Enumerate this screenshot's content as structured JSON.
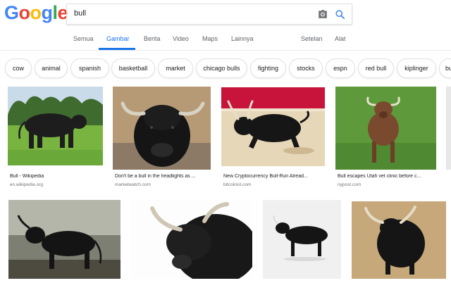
{
  "search": {
    "query": "bull"
  },
  "tabs": [
    {
      "label": "Semua"
    },
    {
      "label": "Gambar"
    },
    {
      "label": "Berita"
    },
    {
      "label": "Video"
    },
    {
      "label": "Maps"
    },
    {
      "label": "Lainnya"
    },
    {
      "label": "Setelan"
    },
    {
      "label": "Alat"
    }
  ],
  "chips": [
    "cow",
    "animal",
    "spanish",
    "basketball",
    "market",
    "chicago bulls",
    "fighting",
    "stocks",
    "espn",
    "red bull",
    "kiplinger",
    "bu"
  ],
  "results": [
    {
      "title": "Bull - Wikipedia",
      "source": "en.wikipedia.org"
    },
    {
      "title": "Don't be a bull in the headlights as ...",
      "source": "marketwatch.com"
    },
    {
      "title": "New Cryptocurrency Bull-Run Alread...",
      "source": "bitcoinist.com"
    },
    {
      "title": "Bull escapes Utah vet clinic before c...",
      "source": "nypost.com"
    }
  ],
  "colors": {
    "accent": "#1a73e8",
    "google_blue": "#4285f4",
    "google_red": "#ea4335",
    "google_yellow": "#fbbc05",
    "google_green": "#34a853"
  }
}
